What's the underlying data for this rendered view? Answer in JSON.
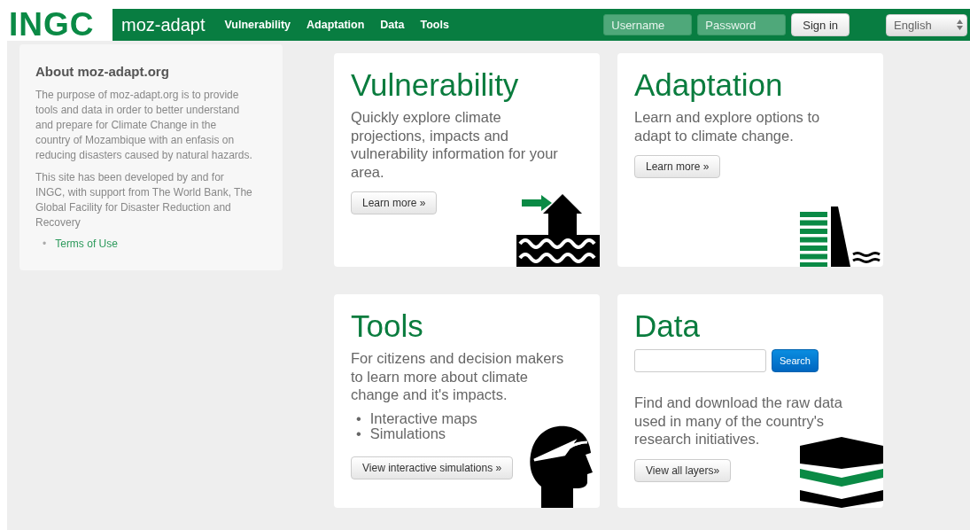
{
  "logo": {
    "text": "INGC"
  },
  "navbar": {
    "brand": "moz-adapt",
    "links": [
      "Vulnerability",
      "Adaptation",
      "Data",
      "Tools"
    ],
    "username": {
      "placeholder": "Username"
    },
    "password": {
      "placeholder": "Password"
    },
    "sign_in": "Sign in",
    "language": "English"
  },
  "sidebar": {
    "title": "About moz-adapt.org",
    "paragraphs": [
      "The purpose of moz-adapt.org is to provide tools and data in order to better understand and prepare for Climate Change in the country of Mozambique with an enfasis on reducing disasters caused by natural hazards.",
      "This site has been developed by and for INGC, with support from The World Bank, The Global Facility for Disaster Reduction and Recovery"
    ],
    "links": [
      {
        "marker": "•",
        "text": "Terms of Use"
      }
    ]
  },
  "cards": [
    {
      "kind": "text",
      "title": "Vulnerability",
      "text": "Quickly explore climate projections, impacts and vulnerability information for your area.",
      "button": "Learn more »"
    },
    {
      "kind": "text",
      "title": "Adaptation",
      "text": "Learn and explore options to adapt to climate change.",
      "button": "Learn more »"
    },
    {
      "kind": "list",
      "title": "Tools",
      "text": "For citizens and decision makers to learn more about climate change and it's impacts.",
      "items": [
        {
          "marker": "•",
          "text": "Interactive maps"
        },
        {
          "marker": "•",
          "text": "Simulations"
        }
      ],
      "button": "View interactive simulations »"
    },
    {
      "kind": "search",
      "title": "Data",
      "search_button": "Search",
      "text": "Find and download the raw data used in many of the country's research initiatives.",
      "button": "View all layers»"
    }
  ]
}
